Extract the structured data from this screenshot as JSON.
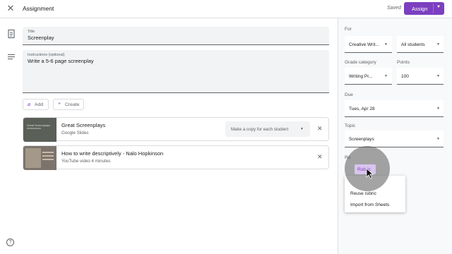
{
  "header": {
    "title": "Assignment",
    "saved": "Saved",
    "assign_label": "Assign"
  },
  "form": {
    "title_label": "Title",
    "title_value": "Screenplay",
    "instructions_label": "Instructions (optional)",
    "instructions_value": "Write a 5-6 page screenplay",
    "add_label": "Add",
    "create_label": "Create"
  },
  "attachments": [
    {
      "title": "Great Screenplays",
      "subtitle": "Google Slides",
      "thumb_text": "Great Screenplays",
      "copy_option": "Make a copy for each student"
    },
    {
      "title": "How to write descriptively - Nalo Hopkinson",
      "subtitle": "YouTube video   4 minutes"
    }
  ],
  "sidebar": {
    "for_label": "For",
    "class_value": "Creative Writ...",
    "students_value": "All students",
    "grade_category_label": "Grade category",
    "grade_category_value": "Writing Pr...",
    "points_label": "Points",
    "points_value": "100",
    "due_label": "Due",
    "due_value": "Tues, Apr 28",
    "topic_label": "Topic",
    "topic_value": "Screenplays",
    "rubric_label": "Ru"
  },
  "rubric_menu": {
    "chip_label": "Rubric",
    "items": [
      "Reuse rubric",
      "Import from Sheets"
    ]
  },
  "colors": {
    "accent": "#7b3fbf",
    "chip": "#d9c4ef"
  },
  "icons": [
    "close-icon",
    "assignment-doc-icon",
    "description-icon",
    "attach-icon",
    "plus-icon",
    "remove-icon",
    "help-icon",
    "cursor-icon"
  ]
}
